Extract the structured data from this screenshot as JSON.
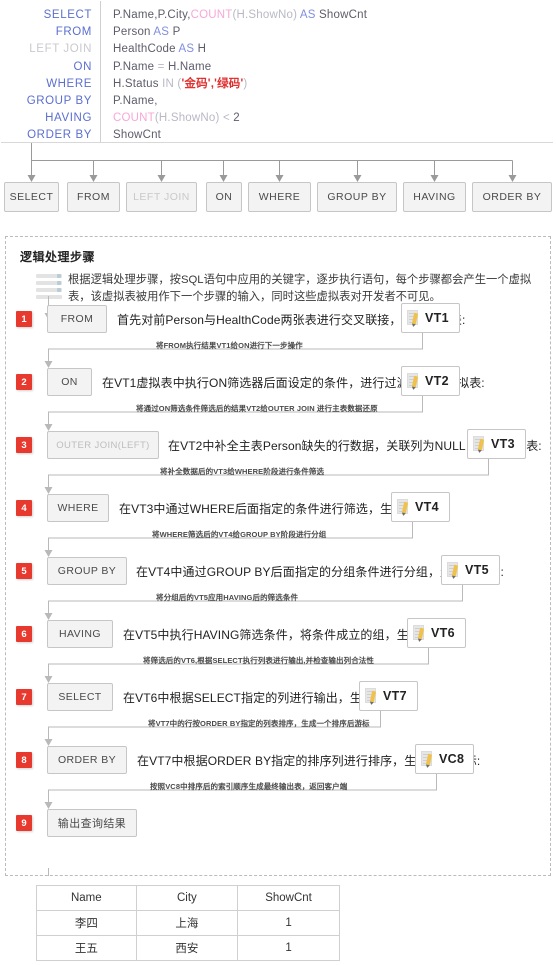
{
  "sql": {
    "keywords": [
      {
        "text": "SELECT",
        "dim": false
      },
      {
        "text": "FROM",
        "dim": false
      },
      {
        "text": "LEFT JOIN",
        "dim": true
      },
      {
        "text": "ON",
        "dim": false
      },
      {
        "text": "WHERE",
        "dim": false
      },
      {
        "text": "GROUP BY",
        "dim": false
      },
      {
        "text": "HAVING",
        "dim": false
      },
      {
        "text": "ORDER BY",
        "dim": false
      }
    ],
    "lines": [
      "P.Name,P.City,COUNT(H.ShowNo) AS ShowCnt",
      "Person AS P",
      "HealthCode AS H",
      "P.Name = H.Name",
      "H.Status IN ('金码','绿码')",
      "P.Name,",
      "COUNT(H.ShowNo) < 2",
      "ShowCnt"
    ],
    "tokens": {
      "l1_a": "P.Name,P.City,",
      "l1_fn": "COUNT",
      "l1_b": "(H.ShowNo)",
      "l1_as": "AS",
      "l1_c": "ShowCnt",
      "l2_a": "Person",
      "l2_as": "AS",
      "l2_b": "P",
      "l3_a": "HealthCode",
      "l3_as": "AS",
      "l3_b": "H",
      "l4_a": "P.Name",
      "l4_op": "=",
      "l4_b": "H.Name",
      "l5_a": "H.Status",
      "l5_in": "IN",
      "l5_p1": "(",
      "l5_s1": "'金码'",
      "l5_sep": ",",
      "l5_s2": "'绿码'",
      "l5_p2": ")",
      "l6_a": "P.Name,",
      "l7_fn": "COUNT",
      "l7_b": "(H.ShowNo)",
      "l7_op": "<",
      "l7_c": "2",
      "l8_a": "ShowCnt"
    }
  },
  "keyword_boxes": [
    {
      "label": "SELECT",
      "dim": false
    },
    {
      "label": "FROM",
      "dim": false
    },
    {
      "label": "LEFT JOIN",
      "dim": true
    },
    {
      "label": "ON",
      "dim": false
    },
    {
      "label": "WHERE",
      "dim": false
    },
    {
      "label": "GROUP BY",
      "dim": false
    },
    {
      "label": "HAVING",
      "dim": false
    },
    {
      "label": "ORDER BY",
      "dim": false
    }
  ],
  "panel": {
    "title": "逻辑处理步骤",
    "intro": "根据逻辑处理步骤，按SQL语句中应用的关键字，逐步执行语句，每个步骤都会产生一个虚拟表，该虚拟表被用作下一个步骤的输入，同时这些虚拟表对开发者不可见。"
  },
  "steps": [
    {
      "num": "1",
      "op": "FROM",
      "op_dim": false,
      "desc": "首先对前Person与HealthCode两张表进行交叉联接，生成虚拟表:",
      "vt": "VT1",
      "connector": "将FROM执行结果VT1给ON进行下一步操作"
    },
    {
      "num": "2",
      "op": "ON",
      "op_dim": false,
      "desc": "在VT1虚拟表中执行ON筛选器后面设定的条件，进行过滤，生成虚拟表:",
      "vt": "VT2",
      "connector": "将通过ON筛选条件筛选后的结果VT2给OUTER JOIN 进行主表数据还原"
    },
    {
      "num": "3",
      "op": "OUTER JOIN(LEFT)",
      "op_dim": true,
      "desc": "在VT2中补全主表Person缺失的行数据，关联列为NULL，生成虚拟表:",
      "vt": "VT3",
      "connector": "将补全数据后的VT3给WHERE阶段进行条件筛选"
    },
    {
      "num": "4",
      "op": "WHERE",
      "op_dim": false,
      "desc": "在VT3中通过WHERE后面指定的条件进行筛选，生成虚拟表:",
      "vt": "VT4",
      "connector": "将WHERE筛选后的VT4给GROUP BY阶段进行分组"
    },
    {
      "num": "5",
      "op": "GROUP BY",
      "op_dim": false,
      "desc": "在VT4中通过GROUP BY后面指定的分组条件进行分组，生成虚拟表:",
      "vt": "VT5",
      "connector": "将分组后的VT5应用HAVING后的筛选条件"
    },
    {
      "num": "6",
      "op": "HAVING",
      "op_dim": false,
      "desc": "在VT5中执行HAVING筛选条件，将条件成立的组，生成虚拟表:",
      "vt": "VT6",
      "connector": "将筛选后的VT6,根据SELECT执行列表进行输出,并检查输出列合法性"
    },
    {
      "num": "7",
      "op": "SELECT",
      "op_dim": false,
      "desc": "在VT6中根据SELECT指定的列进行输出，生成虚拟表:",
      "vt": "VT7",
      "connector": "将VT7中的行按ORDER BY指定的列表排序，生成一个排序后游标"
    },
    {
      "num": "8",
      "op": "ORDER BY",
      "op_dim": false,
      "desc": "在VT7中根据ORDER BY指定的排序列进行排序，生成排序游标:",
      "vt": "VC8",
      "connector": "按照VC8中排序后的索引顺序生成最终输出表，返回客户端"
    },
    {
      "num": "9",
      "op": "输出查询结果",
      "op_dim": false,
      "desc": "",
      "vt": "",
      "connector": ""
    }
  ],
  "result_table": {
    "columns": [
      "Name",
      "City",
      "ShowCnt"
    ],
    "rows": [
      [
        "李四",
        "上海",
        "1"
      ],
      [
        "王五",
        "西安",
        "1"
      ]
    ]
  },
  "colors": {
    "badge": "#e8392f",
    "keyword": "#5b6fcf",
    "function": "#f7a8d8",
    "string": "#e03030",
    "box_bg": "#f3f3f3",
    "box_border": "#c6c6c6"
  }
}
